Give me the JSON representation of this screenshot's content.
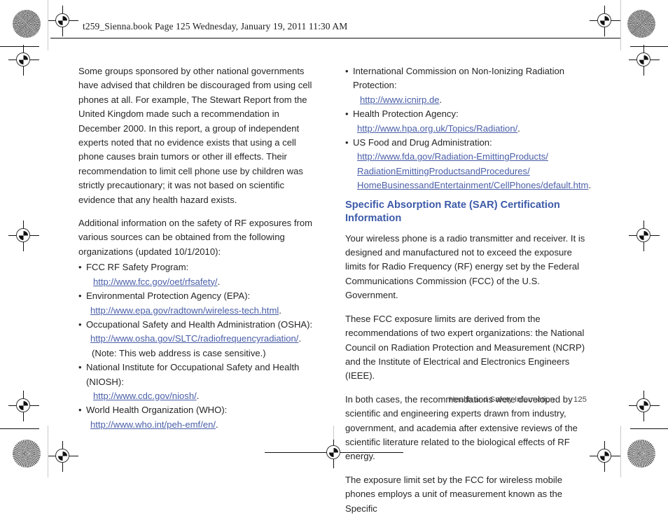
{
  "header": {
    "text": "t259_Sienna.book  Page 125  Wednesday, January 19, 2011  11:30 AM"
  },
  "left_column": {
    "paragraph_1": "Some groups sponsored by other national governments have advised that children be discouraged from using cell phones at all. For example, The Stewart Report from the United Kingdom made such a recommendation in December 2000. In this report, a group of independent experts noted that no evidence exists that using a cell phone causes brain tumors or other ill effects. Their recommendation to limit cell phone use by children was strictly precautionary; it was not based on scientific evidence that any health hazard exists.",
    "paragraph_2": "Additional information on the safety of RF exposures from various sources can be obtained from the following organizations (updated 10/1/2010):",
    "bullet_char": "•",
    "organizations": [
      {
        "label": "FCC RF Safety Program:",
        "url": "http://www.fcc.gov/oet/rfsafety/",
        "period": ".",
        "note": ""
      },
      {
        "label": "Environmental Protection Agency (EPA):",
        "url": "http://www.epa.gov/radtown/wireless-tech.html",
        "period": ".",
        "note": ""
      },
      {
        "label": "Occupational Safety and Health Administration (OSHA):",
        "url": "http://www.osha.gov/SLTC/radiofrequencyradiation/",
        "period": ".",
        "note": "(Note: This web address is case sensitive.)"
      },
      {
        "label": "National Institute for Occupational Safety and Health (NIOSH):",
        "url": "http://www.cdc.gov/niosh/",
        "period": ".",
        "note": ""
      },
      {
        "label": "World Health Organization (WHO):",
        "url": "http://www.who.int/peh-emf/en/",
        "period": ".",
        "note": ""
      }
    ]
  },
  "right_column": {
    "bullet_char": "•",
    "organizations": [
      {
        "label": "International Commission on Non-Ionizing Radiation Protection:",
        "url": "http://www.icnirp.de",
        "period": "."
      },
      {
        "label": "Health Protection Agency:",
        "url": "http://www.hpa.org.uk/Topics/Radiation/",
        "period": "."
      },
      {
        "label": "US Food and Drug Administration:",
        "url": "http://www.fda.gov/Radiation-EmittingProducts/",
        "url_line_2": "RadiationEmittingProductsandProcedures/",
        "url_line_3": "HomeBusinessandEntertainment/CellPhones/default.htm",
        "period": "."
      }
    ],
    "section_heading": "Specific Absorption Rate (SAR) Certification Information",
    "paragraph_1": "Your wireless phone is a radio transmitter and receiver. It is designed and manufactured not to exceed the exposure limits for Radio Frequency (RF) energy set by the Federal Communications Commission (FCC) of the U.S. Government.",
    "paragraph_2": "These FCC exposure limits are derived from the recommendations of two expert organizations: the National Council on Radiation Protection and Measurement (NCRP) and the Institute of Electrical and Electronics Engineers (IEEE).",
    "paragraph_3": "In both cases, the recommendations were developed by scientific and engineering experts drawn from industry, government, and academia after extensive reviews of the scientific literature related to the biological effects of RF energy.",
    "paragraph_4": "The exposure limit set by the FCC for wireless mobile phones employs a unit of measurement known as the Specific"
  },
  "footer": {
    "chapter": "Health and Safety Information",
    "page_number": "125"
  },
  "colors": {
    "link": "#4a5fa8",
    "heading": "#3c5aa8",
    "body_text": "#262626",
    "footer_text": "#4a4a4a"
  }
}
